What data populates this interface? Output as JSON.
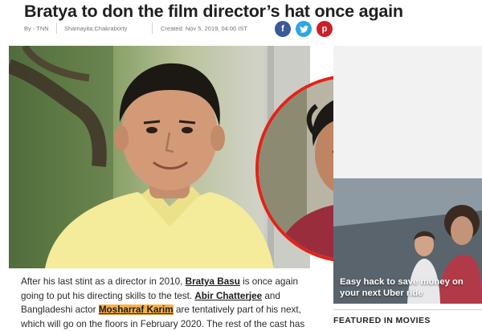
{
  "article": {
    "headline": "Bratya to don the film director’s hat once again",
    "byline_source": "By - TNN",
    "author": "Shamayita.Chakraborty",
    "created": "Created: Nov 5, 2019, 04:00 IST",
    "body_segments": [
      "After his last stint as a director in 2010, ",
      "Bratya Basu",
      " is once again going to put his directing skills to the test. ",
      "Abir Chatterjee",
      " and Bangladeshi actor ",
      "Mosharraf Karim",
      " are tentatively part of his next, which will go on the floors in February 2020. The rest of the cast has"
    ]
  },
  "share": {
    "facebook_icon": "f",
    "twitter_icon": "🐦",
    "pinterest_icon": "p",
    "colors": {
      "facebook": "#3b5998",
      "twitter": "#2ea6e6",
      "pinterest": "#cb2027"
    }
  },
  "sidebar": {
    "ad_text": "Easy hack to save money on your next Uber ride",
    "featured_title": "FEATURED IN MOVIES"
  },
  "accent_colors": {
    "inset_ring": "#e2231a",
    "highlight": "#f6b24a"
  }
}
